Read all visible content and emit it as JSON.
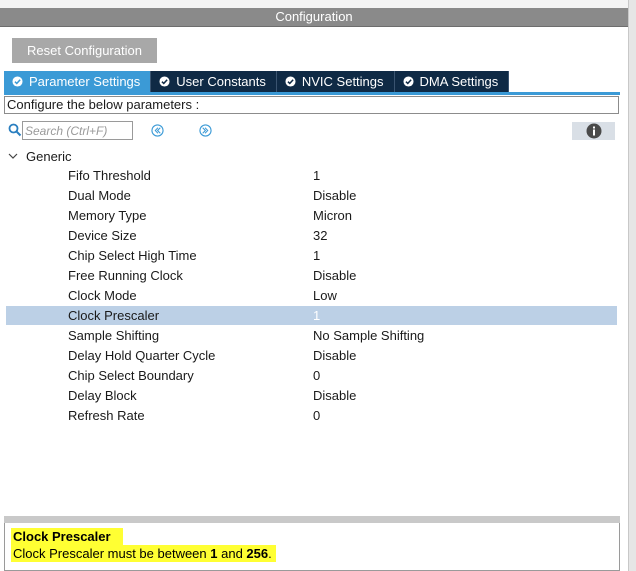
{
  "window": {
    "title": "Configuration"
  },
  "toolbar": {
    "reset_label": "Reset Configuration"
  },
  "tabs": [
    {
      "label": "Parameter Settings",
      "active": true
    },
    {
      "label": "User Constants",
      "active": false
    },
    {
      "label": "NVIC Settings",
      "active": false
    },
    {
      "label": "DMA Settings",
      "active": false
    }
  ],
  "configure_text": "Configure the below parameters :",
  "search": {
    "placeholder": "Search (Ctrl+F)"
  },
  "icons": {
    "search": "search-icon",
    "prev": "arrow-left-circle-icon",
    "next": "arrow-right-circle-icon",
    "info": "info-icon",
    "chevron": "chevron-down-icon",
    "tab_check": "check-circle-icon"
  },
  "colors": {
    "accent": "#3b9ad6",
    "tab_bg": "#0f2a45",
    "selection": "#bcd0e6",
    "highlight": "#ffff33"
  },
  "group": {
    "label": "Generic"
  },
  "params": [
    {
      "name": "Fifo Threshold",
      "value": "1"
    },
    {
      "name": "Dual Mode",
      "value": "Disable"
    },
    {
      "name": "Memory Type",
      "value": "Micron"
    },
    {
      "name": "Device Size",
      "value": "32"
    },
    {
      "name": "Chip Select High Time",
      "value": "1"
    },
    {
      "name": "Free Running Clock",
      "value": "Disable"
    },
    {
      "name": "Clock Mode",
      "value": "Low"
    },
    {
      "name": "Clock Prescaler",
      "value": "1",
      "selected": true
    },
    {
      "name": "Sample Shifting",
      "value": "No Sample Shifting"
    },
    {
      "name": "Delay Hold Quarter Cycle",
      "value": "Disable"
    },
    {
      "name": "Chip Select Boundary",
      "value": "0"
    },
    {
      "name": "Delay Block",
      "value": "Disable"
    },
    {
      "name": "Refresh Rate",
      "value": "0"
    }
  ],
  "description": {
    "title": "Clock Prescaler",
    "prefix": "Clock Prescaler must be between ",
    "min": "1",
    "middle": " and ",
    "max": "256",
    "suffix": "."
  }
}
